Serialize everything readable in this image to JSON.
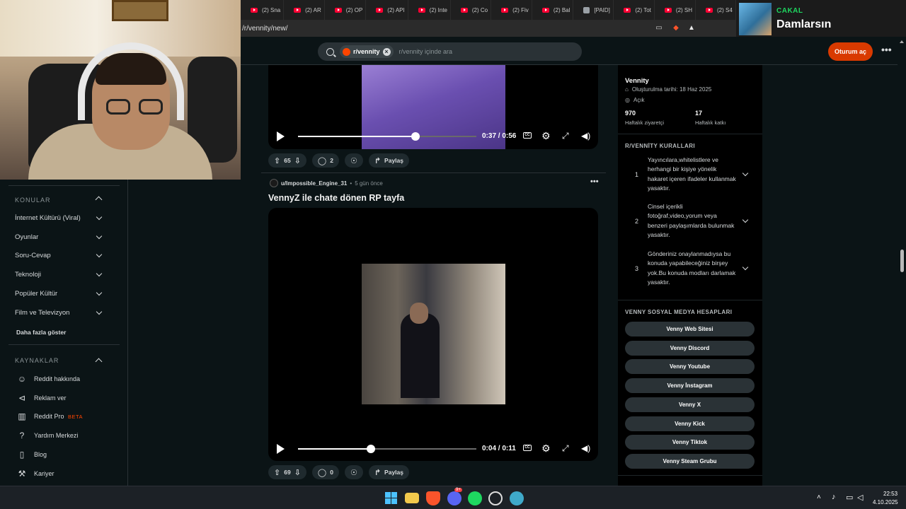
{
  "browser": {
    "tabs": [
      {
        "label": "(2) Sna",
        "kind": "yt"
      },
      {
        "label": "(2) AR",
        "kind": "yt"
      },
      {
        "label": "(2) OP",
        "kind": "yt"
      },
      {
        "label": "(2) API",
        "kind": "yt"
      },
      {
        "label": "(2) Inte",
        "kind": "yt"
      },
      {
        "label": "(2) Co",
        "kind": "yt"
      },
      {
        "label": "(2) Fiv",
        "kind": "yt"
      },
      {
        "label": "(2) Bal",
        "kind": "yt"
      },
      {
        "label": "[PAID]",
        "kind": "gen"
      },
      {
        "label": "(2) Tot",
        "kind": "yt"
      },
      {
        "label": "(2) SH",
        "kind": "yt"
      },
      {
        "label": "(2) S4",
        "kind": "yt"
      }
    ],
    "url": "/r/vennity/new/"
  },
  "spotify": {
    "artist": "CAKAL",
    "song": "Damlarsın"
  },
  "header": {
    "chip_label": "r/vennity",
    "search_placeholder": "r/vennity içinde ara",
    "login_label": "Oturum aç",
    "more_glyph": "•••"
  },
  "sidebar": {
    "topics_title": "KONULAR",
    "topics": [
      "İnternet Kültürü (Viral)",
      "Oyunlar",
      "Soru-Cevap",
      "Teknoloji",
      "Popüler Kültür",
      "Film ve Televizyon"
    ],
    "more_label": "Daha fazla göster",
    "resources_title": "KAYNAKLAR",
    "resources": [
      {
        "label": "Reddit hakkında",
        "icon": "reddit-icon"
      },
      {
        "label": "Reklam ver",
        "icon": "megaphone-icon"
      },
      {
        "label": "Reddit Pro",
        "icon": "bar-chart-icon",
        "badge": "BETA"
      },
      {
        "label": "Yardım Merkezi",
        "icon": "help-icon"
      },
      {
        "label": "Blog",
        "icon": "book-icon"
      },
      {
        "label": "Kariyer",
        "icon": "wrench-icon"
      }
    ]
  },
  "posts": [
    {
      "video_time": "0:37 / 0:56",
      "progress": 0.66,
      "votes": "65",
      "comments": "2",
      "share_label": "Paylaş"
    },
    {
      "author": "u/Impossible_Engine_31",
      "age": "5 gün önce",
      "title": "VennyZ ile chate dönen RP tayfa",
      "video_time": "0:04 / 0:11",
      "progress": 0.41,
      "votes": "69",
      "comments": "0",
      "share_label": "Paylaş"
    }
  ],
  "community": {
    "name": "Vennity",
    "created": "Oluşturulma tarihi: 18 Haz 2025",
    "visibility": "Açık",
    "visitors": "970",
    "visitors_label": "Haftalık ziyaretçi",
    "contributions": "17",
    "contributions_label": "Haftalık katkı",
    "rules_title": "R/VENNİTY KURALLARI",
    "rules": [
      {
        "num": "1",
        "text": "Yayıncılara,whitelistlere ve herhangi bir kişiye yönelik hakaret içeren ifadeler kullanmak yasaktır."
      },
      {
        "num": "2",
        "text": "Cinsel içerikli fotoğraf,video,yorum veya benzeri paylaşımlarda bulunmak yasaktır."
      },
      {
        "num": "3",
        "text": "Gönderiniz onaylanmadıysa bu konuda yapabileceğiniz birşey yok.Bu konuda modları darlamak yasaktır."
      }
    ],
    "social_title": "VENNY SOSYAL MEDYA HESAPLARI",
    "social_links": [
      "Venny Web Sitesi",
      "Venny Discord",
      "Venny Youtube",
      "Venny İnstagram",
      "Venny X",
      "Venny Kick",
      "Venny Tiktok",
      "Venny Steam Grubu"
    ]
  },
  "taskbar": {
    "time": "22:53",
    "date": "4.10.2025",
    "discord_badge": "9+"
  },
  "colors": {
    "accent": "#d93a00",
    "reddit_orange": "#ff4500",
    "spotify_green": "#1ed760",
    "background": "#0b1416"
  }
}
